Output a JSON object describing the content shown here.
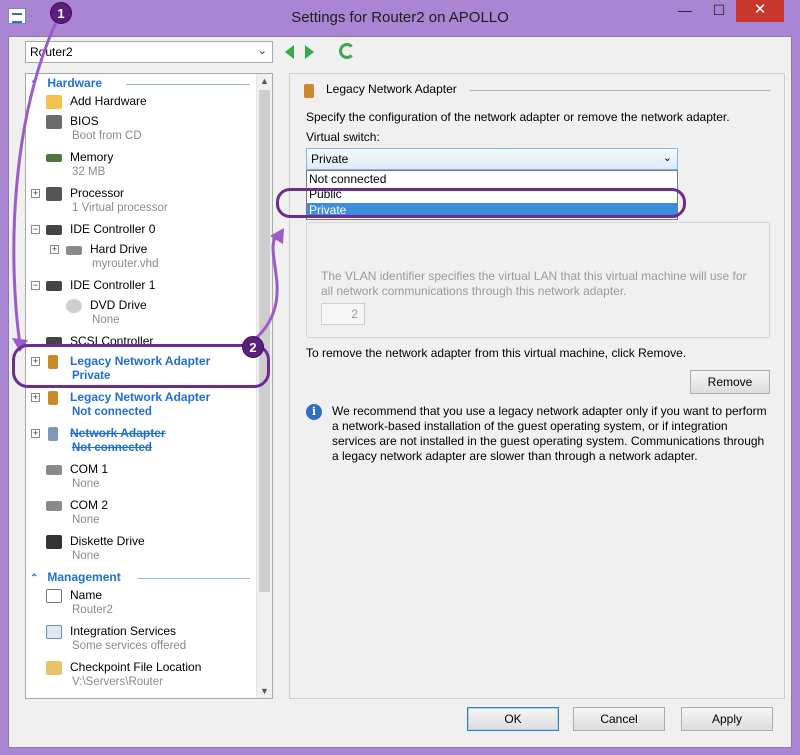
{
  "window": {
    "title": "Settings for Router2 on APOLLO"
  },
  "vm_selector": {
    "value": "Router2"
  },
  "hardware": {
    "header": "Hardware",
    "items": [
      {
        "label": "Add Hardware",
        "sub": ""
      },
      {
        "label": "BIOS",
        "sub": "Boot from CD"
      },
      {
        "label": "Memory",
        "sub": "32 MB"
      },
      {
        "label": "Processor",
        "sub": "1 Virtual processor"
      },
      {
        "label": "IDE Controller 0",
        "sub": ""
      },
      {
        "label": "Hard Drive",
        "sub": "myrouter.vhd"
      },
      {
        "label": "IDE Controller 1",
        "sub": ""
      },
      {
        "label": "DVD Drive",
        "sub": "None"
      },
      {
        "label": "SCSI Controller",
        "sub": ""
      },
      {
        "label": "Legacy Network Adapter",
        "sub": "Private"
      },
      {
        "label": "Legacy Network Adapter",
        "sub": "Not connected"
      },
      {
        "label": "Network Adapter",
        "sub": "Not connected"
      },
      {
        "label": "COM 1",
        "sub": "None"
      },
      {
        "label": "COM 2",
        "sub": "None"
      },
      {
        "label": "Diskette Drive",
        "sub": "None"
      }
    ]
  },
  "management": {
    "header": "Management",
    "items": [
      {
        "label": "Name",
        "sub": "Router2"
      },
      {
        "label": "Integration Services",
        "sub": "Some services offered"
      },
      {
        "label": "Checkpoint File Location",
        "sub": "V:\\Servers\\Router"
      }
    ]
  },
  "detail": {
    "header": "Legacy Network Adapter",
    "description": "Specify the configuration of the network adapter or remove the network adapter.",
    "virtual_switch_label": "Virtual switch:",
    "virtual_switch_value": "Private",
    "options": [
      "Not connected",
      "Public",
      "Private"
    ],
    "vlan_text": "The VLAN identifier specifies the virtual LAN that this virtual machine will use for all network communications through this network adapter.",
    "vlan_id": "2",
    "remove_text": "To remove the network adapter from this virtual machine, click Remove.",
    "remove_label": "Remove",
    "info_text": "We recommend that you use a legacy network adapter only if you want to perform a network-based installation of the guest operating system, or if integration services are not installed in the guest operating system. Communications through a legacy network adapter are slower than through a network adapter."
  },
  "footer": {
    "ok": "OK",
    "cancel": "Cancel",
    "apply": "Apply"
  },
  "callouts": {
    "one": "1",
    "two": "2"
  },
  "colors": {
    "accent": "#1f6fd0",
    "callout": "#6a2f8e",
    "selection": "#3c8dde",
    "nav_green": "#39a84a"
  }
}
